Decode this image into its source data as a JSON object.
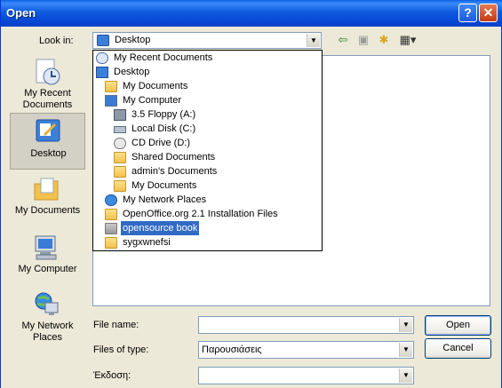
{
  "window": {
    "title": "Open"
  },
  "toolbar": {
    "look_in_label": "Look in:",
    "look_in_value": "Desktop"
  },
  "places": [
    {
      "label": "My Recent Documents",
      "icon": "recent-documents-icon"
    },
    {
      "label": "Desktop",
      "icon": "desktop-icon"
    },
    {
      "label": "My Documents",
      "icon": "my-documents-icon"
    },
    {
      "label": "My Computer",
      "icon": "my-computer-icon"
    },
    {
      "label": "My Network Places",
      "icon": "network-places-icon"
    }
  ],
  "dropdown": {
    "items": [
      {
        "label": "My Recent Documents",
        "icon": "recent-documents-icon"
      },
      {
        "label": "Desktop",
        "icon": "desktop-icon"
      },
      {
        "label": "My Documents",
        "icon": "my-documents-icon"
      },
      {
        "label": "My Computer",
        "icon": "my-computer-icon"
      },
      {
        "label": "3.5 Floppy (A:)",
        "icon": "floppy-icon"
      },
      {
        "label": "Local Disk (C:)",
        "icon": "hard-disk-icon"
      },
      {
        "label": "CD Drive (D:)",
        "icon": "cd-drive-icon"
      },
      {
        "label": "Shared Documents",
        "icon": "folder-icon"
      },
      {
        "label": "admin's Documents",
        "icon": "folder-icon"
      },
      {
        "label": "My Documents",
        "icon": "folder-icon"
      },
      {
        "label": "My Network Places",
        "icon": "network-places-icon"
      },
      {
        "label": "OpenOffice.org 2.1 Installation Files",
        "icon": "folder-icon"
      },
      {
        "label": "opensource book",
        "icon": "folder-icon",
        "selected": true
      },
      {
        "label": "sygxwnefsi",
        "icon": "folder-icon"
      }
    ]
  },
  "form": {
    "file_name_label": "File name:",
    "file_name_value": "",
    "files_of_type_label": "Files of type:",
    "files_of_type_value": "Παρουσιάσεις",
    "version_label": "Έκδοση:",
    "version_value": ""
  },
  "buttons": {
    "open": "Open",
    "cancel": "Cancel"
  },
  "colors": {
    "titlebar": "#0A5FE6",
    "selection": "#316AC5",
    "window_bg": "#ECE9D8"
  }
}
